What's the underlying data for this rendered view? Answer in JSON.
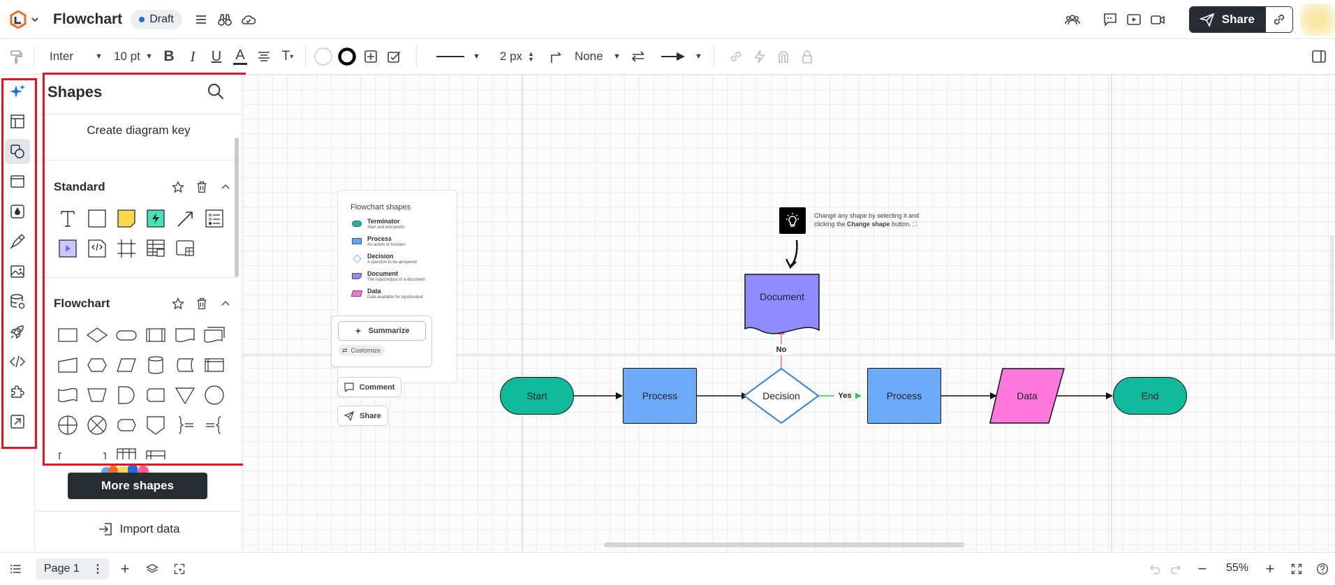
{
  "app": {
    "title": "Flowchart",
    "status": "Draft",
    "share_label": "Share"
  },
  "toolbar": {
    "font": "Inter",
    "font_size": "10 pt",
    "line_width": "2 px",
    "end_style": "None"
  },
  "panel": {
    "title": "Shapes",
    "create_key": "Create diagram key",
    "groups": [
      {
        "name": "Standard"
      },
      {
        "name": "Flowchart"
      }
    ],
    "more_shapes": "More shapes",
    "import_data": "Import data"
  },
  "legend": {
    "title": "Flowchart shapes",
    "items": [
      {
        "name": "Terminator",
        "desc": "Start and end points",
        "color": "#19b99a"
      },
      {
        "name": "Process",
        "desc": "An action or function",
        "color": "#5ea7ff"
      },
      {
        "name": "Decision",
        "desc": "A question to be answered",
        "color": "#7fb4ff"
      },
      {
        "name": "Document",
        "desc": "The input/output of a document",
        "color": "#8f8cff"
      },
      {
        "name": "Data",
        "desc": "Data available for input/output",
        "color": "#ff73d3"
      }
    ]
  },
  "canvas_actions": {
    "summarize": "Summarize",
    "customize": "Customize",
    "comment": "Comment",
    "share": "Share"
  },
  "tip": {
    "text_1": "Change any shape by selecting it and",
    "text_2": "clicking the",
    "bold": "Change shape",
    "text_3": "button."
  },
  "flow": {
    "start": "Start",
    "process1": "Process",
    "decision": "Decision",
    "yes": "Yes",
    "no": "No",
    "process2": "Process",
    "data": "Data",
    "end": "End",
    "document": "Document"
  },
  "colors": {
    "terminator": "#10b99a",
    "process": "#6aaaf7",
    "decision_border": "#2f7fe0",
    "document": "#8f8cff",
    "data": "#ff78dc",
    "highlight": "#e8141e"
  },
  "bottom": {
    "page": "Page 1",
    "zoom": "55%"
  }
}
